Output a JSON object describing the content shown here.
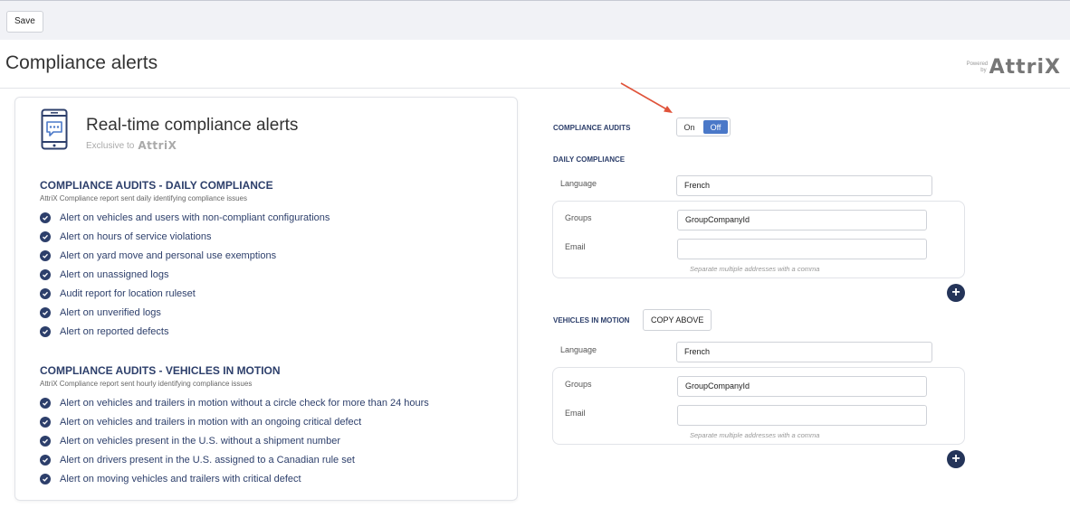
{
  "toolbar": {
    "save_label": "Save"
  },
  "page": {
    "title": "Compliance alerts",
    "powered_by": "Powered by",
    "brand": "AttriX"
  },
  "card": {
    "title": "Real-time compliance alerts",
    "exclusive_label": "Exclusive to",
    "exclusive_brand": "AttriX",
    "daily": {
      "heading": "COMPLIANCE AUDITS - DAILY COMPLIANCE",
      "description": "AttriX Compliance report sent daily identifying compliance issues",
      "items": [
        "Alert on vehicles and users with non-compliant configurations",
        "Alert on hours of service violations",
        "Alert on yard move and personal use exemptions",
        "Alert on unassigned logs",
        "Audit report for location ruleset",
        "Alert on unverified logs",
        "Alert on reported defects"
      ]
    },
    "motion": {
      "heading": "COMPLIANCE AUDITS - VEHICLES IN MOTION",
      "description": "AttriX Compliance report sent hourly identifying compliance issues",
      "items": [
        "Alert on vehicles and trailers in motion without a circle check for more than 24 hours",
        "Alert on vehicles and trailers in motion with an ongoing critical defect",
        "Alert on vehicles present in the U.S. without a shipment number",
        "Alert on drivers present in the U.S. assigned to a Canadian rule set",
        "Alert on moving vehicles and trailers with critical defect"
      ]
    }
  },
  "settings": {
    "compliance_audits_label": "COMPLIANCE AUDITS",
    "toggle_on": "On",
    "toggle_off": "Off",
    "toggle_selected": "Off",
    "daily": {
      "heading": "DAILY COMPLIANCE",
      "language_label": "Language",
      "language_value": "French",
      "groups_label": "Groups",
      "groups_value": "GroupCompanyId",
      "email_label": "Email",
      "email_value": "",
      "email_hint": "Separate multiple addresses with a comma"
    },
    "motion": {
      "heading": "VEHICLES IN MOTION",
      "copy_label": "COPY ABOVE",
      "language_label": "Language",
      "language_value": "French",
      "groups_label": "Groups",
      "groups_value": "GroupCompanyId",
      "email_label": "Email",
      "email_value": "",
      "email_hint": "Separate multiple addresses with a comma"
    },
    "add_symbol": "+"
  },
  "colors": {
    "navy": "#2d3f6b",
    "toggle_active": "#4a78c8",
    "annotation_arrow": "#e0533a"
  }
}
